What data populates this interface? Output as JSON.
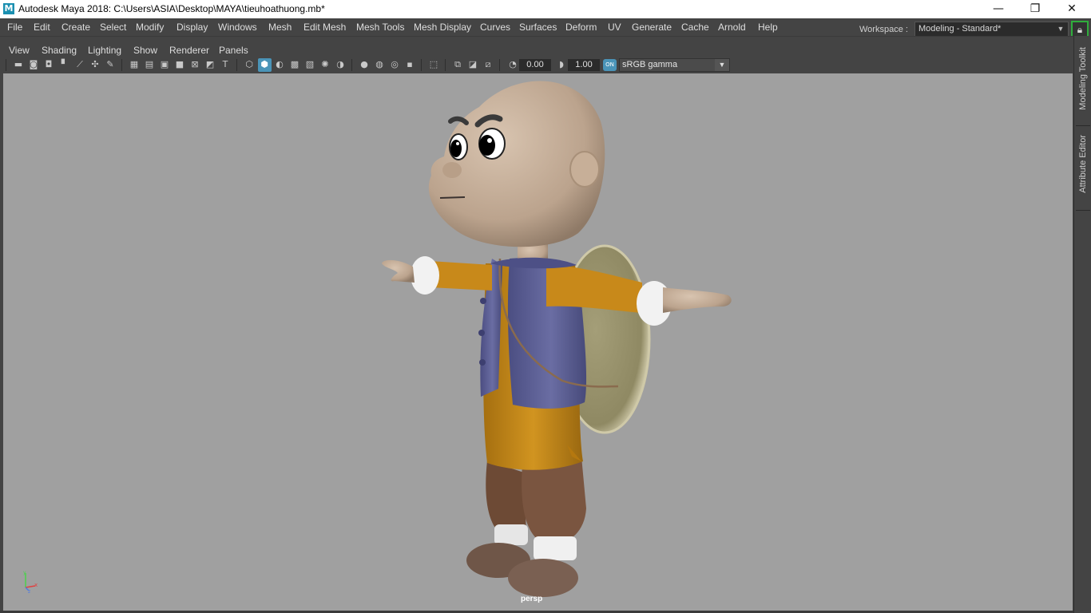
{
  "titlebar": {
    "app_logo": "M",
    "title": "Autodesk Maya 2018: C:\\Users\\ASIA\\Desktop\\MAYA\\tieuhoathuong.mb*",
    "minimize": "—",
    "restore": "❐",
    "close": "✕"
  },
  "menubar": {
    "items": [
      "File",
      "Edit",
      "Create",
      "Select",
      "Modify",
      "Display",
      "Windows",
      "Mesh",
      "Edit Mesh",
      "Mesh Tools",
      "Mesh Display",
      "Curves",
      "Surfaces",
      "Deform",
      "UV",
      "Generate",
      "Cache",
      "Arnold",
      "Help"
    ],
    "workspace_label": "Workspace :",
    "workspace_value": "Modeling - Standard*",
    "lock_icon": "lock-icon"
  },
  "panel": {
    "menus": [
      "View",
      "Shading",
      "Lighting",
      "Show",
      "Renderer",
      "Panels"
    ],
    "exposure": "0.00",
    "gamma": "1.00",
    "color_mgmt_badge": "ON",
    "color_space": "sRGB gamma"
  },
  "viewport": {
    "camera": "persp",
    "background": "#a0a0a0"
  },
  "sidebar": {
    "tabs": [
      "Modeling Toolkit",
      "Attribute Editor"
    ]
  },
  "colors": {
    "ui_dark": "#444444",
    "accent_blue": "#4a94b8",
    "lock_green": "#2fae3c",
    "robe_orange": "#c88a1c",
    "vest_purple": "#5c5f94",
    "pants_brown": "#6e4b36",
    "skin": "#c4ad98"
  }
}
